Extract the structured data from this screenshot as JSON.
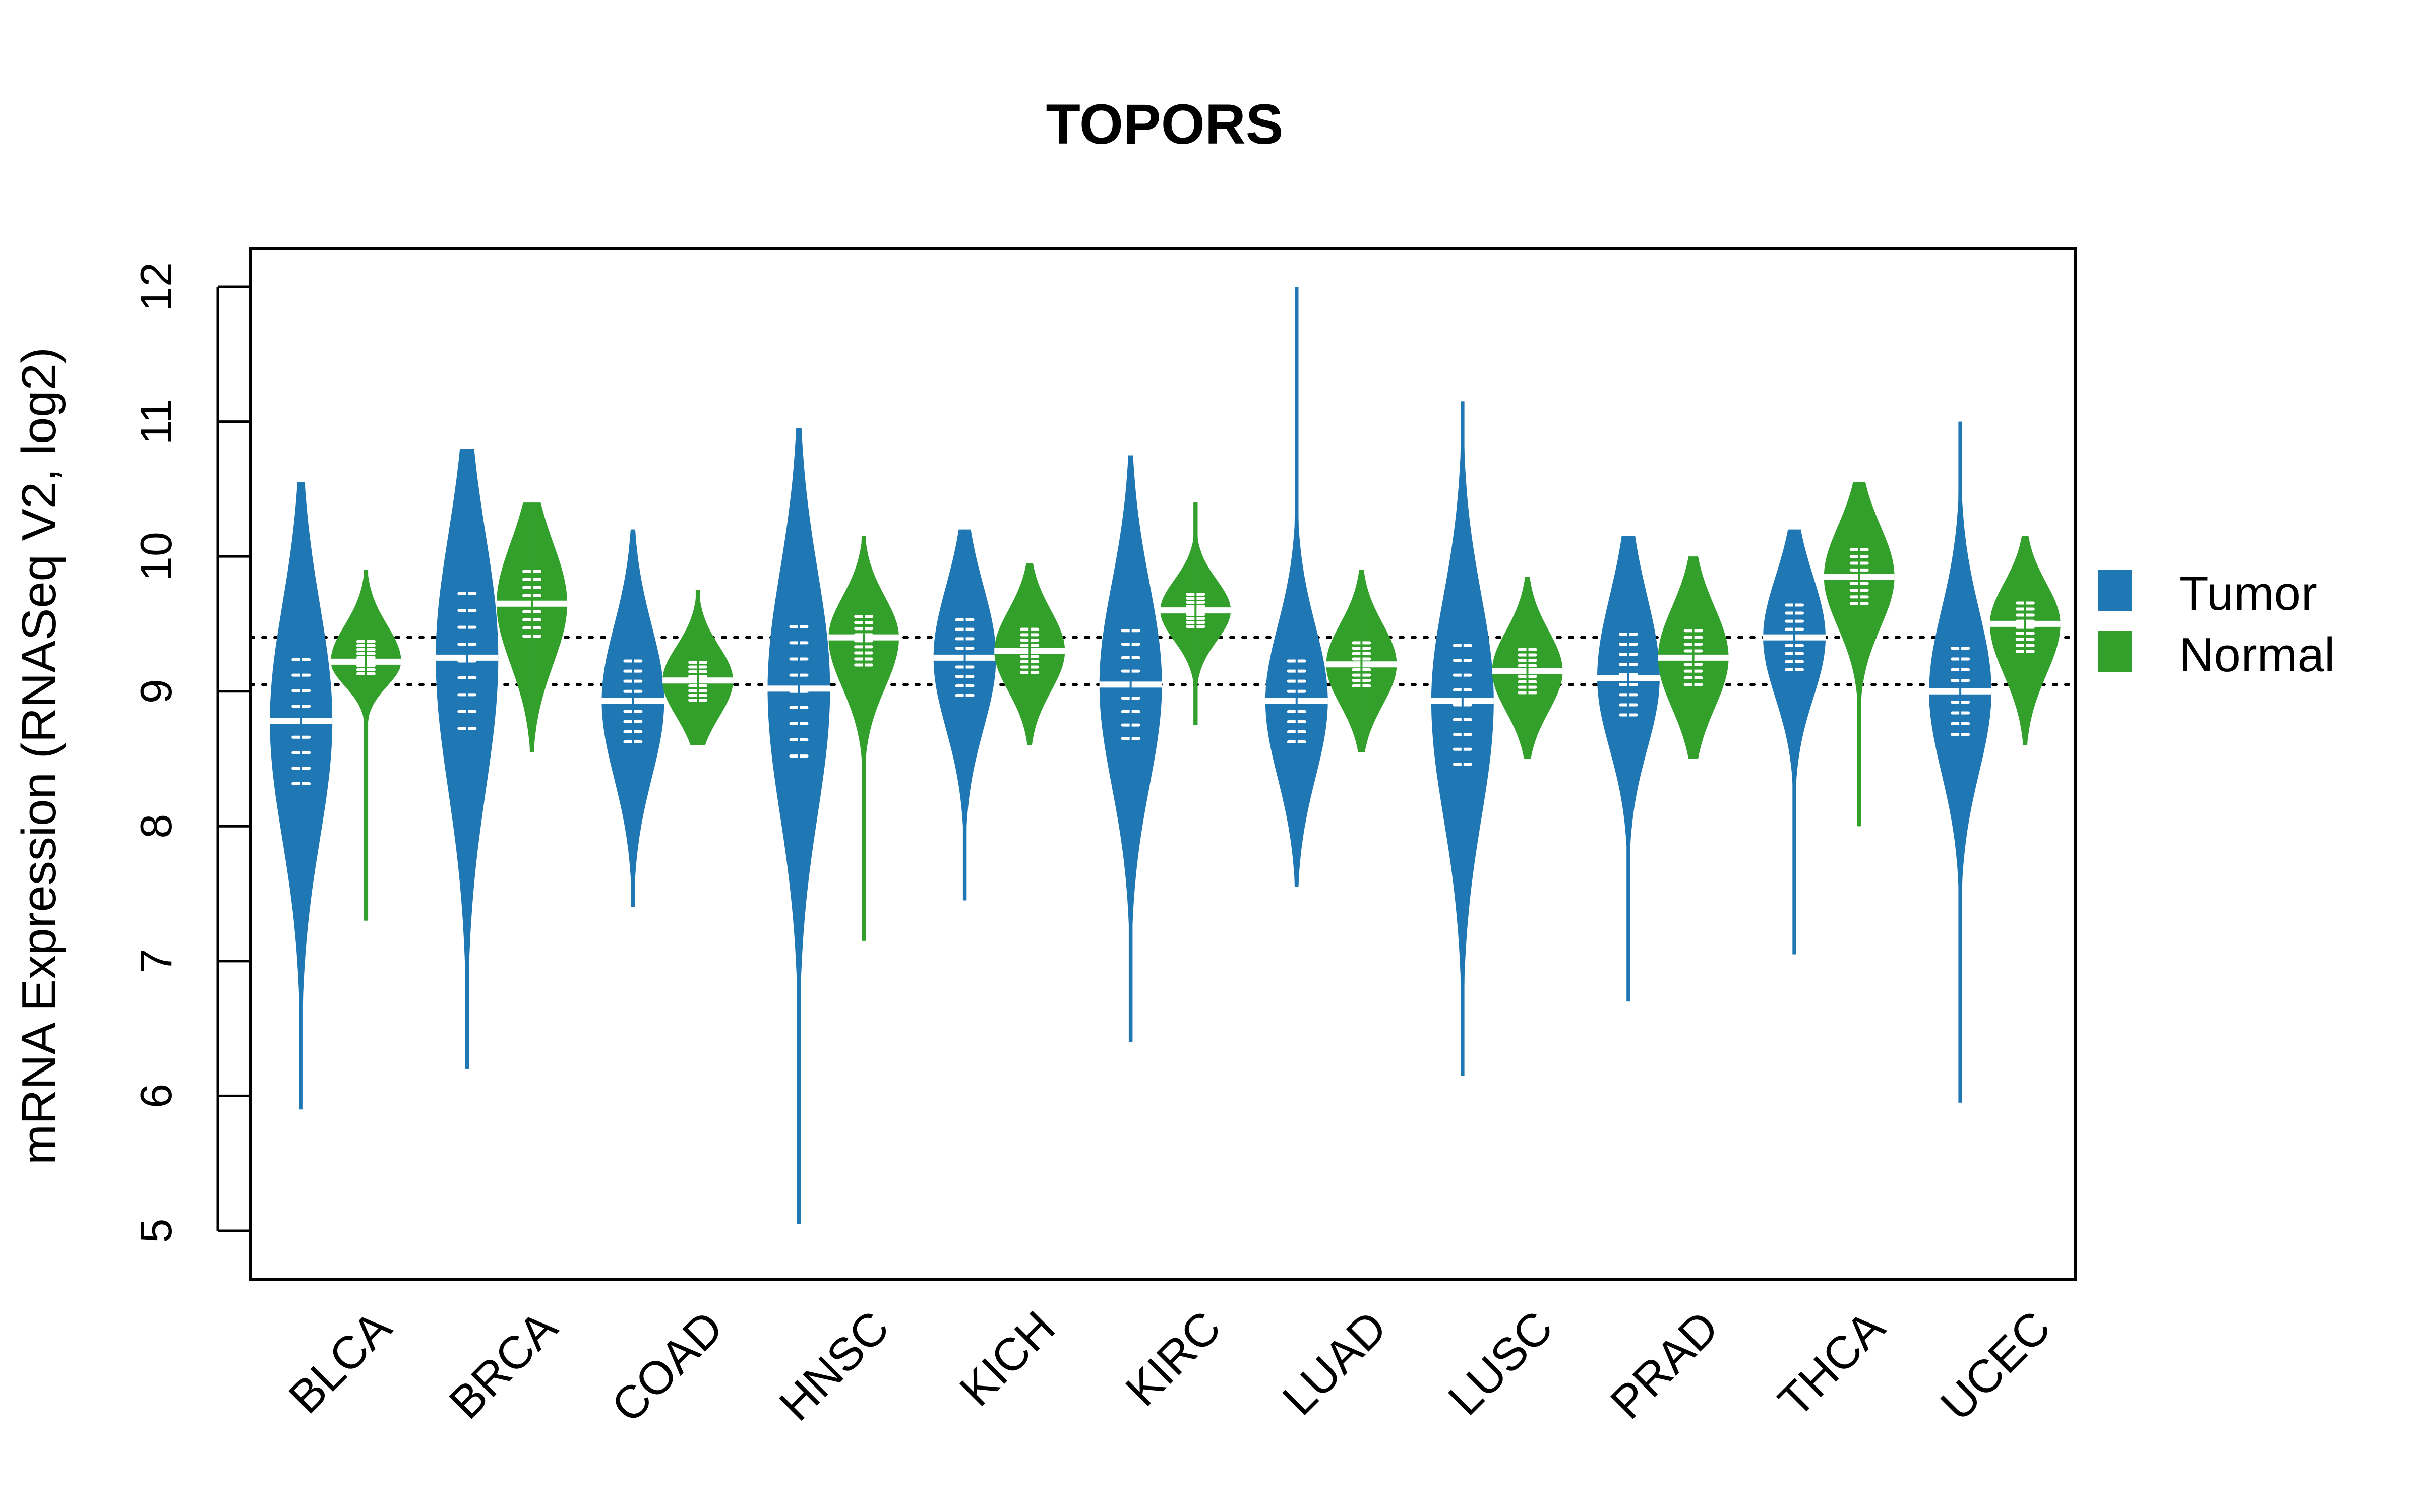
{
  "chart_data": {
    "type": "violin",
    "title": "TOPORS",
    "xlabel": "",
    "ylabel": "mRNA Expression (RNASeq V2, log2)",
    "ylim": [
      4.75,
      12.3
    ],
    "yticks": [
      5,
      6,
      7,
      8,
      9,
      10,
      11,
      12
    ],
    "grid": false,
    "legend": {
      "placement": "right",
      "entries": [
        {
          "name": "Tumor",
          "color": "#1F77B4"
        },
        {
          "name": "Normal",
          "color": "#33A02C"
        }
      ]
    },
    "reference_lines": [
      9.05,
      9.4
    ],
    "categories": [
      "BLCA",
      "BRCA",
      "COAD",
      "HNSC",
      "KICH",
      "KIRC",
      "LUAD",
      "LUSC",
      "PRAD",
      "THCA",
      "UCEC"
    ],
    "series": [
      {
        "name": "Tumor",
        "color": "#1F77B4",
        "median": [
          8.78,
          9.25,
          8.93,
          9.02,
          9.25,
          9.05,
          8.93,
          8.93,
          9.1,
          9.4,
          9.0
        ],
        "q1": [
          8.2,
          8.6,
          8.55,
          8.4,
          8.9,
          8.55,
          8.55,
          8.35,
          8.75,
          9.1,
          8.6
        ],
        "q3": [
          9.35,
          9.85,
          9.3,
          9.6,
          9.6,
          9.55,
          9.3,
          9.45,
          9.5,
          9.7,
          9.4
        ],
        "min": [
          5.9,
          6.2,
          7.4,
          5.05,
          7.45,
          6.4,
          7.55,
          6.15,
          6.7,
          7.05,
          5.95
        ],
        "max": [
          10.55,
          10.8,
          10.2,
          10.95,
          10.2,
          10.75,
          12.0,
          11.15,
          10.15,
          10.2,
          11.0
        ]
      },
      {
        "name": "Normal",
        "color": "#33A02C",
        "median": [
          9.22,
          9.65,
          9.08,
          9.4,
          9.3,
          9.6,
          9.2,
          9.15,
          9.25,
          9.85,
          9.5
        ],
        "q1": [
          9.1,
          9.35,
          8.9,
          9.15,
          9.1,
          9.45,
          9.0,
          8.95,
          9.0,
          9.6,
          9.25
        ],
        "q3": [
          9.4,
          9.95,
          9.25,
          9.6,
          9.5,
          9.75,
          9.4,
          9.35,
          9.5,
          10.1,
          9.7
        ],
        "min": [
          7.3,
          8.55,
          8.6,
          7.15,
          8.6,
          8.75,
          8.55,
          8.5,
          8.5,
          8.0,
          8.6
        ],
        "max": [
          9.9,
          10.4,
          9.75,
          10.15,
          9.95,
          10.4,
          9.9,
          9.85,
          10.0,
          10.55,
          10.15
        ]
      }
    ]
  }
}
